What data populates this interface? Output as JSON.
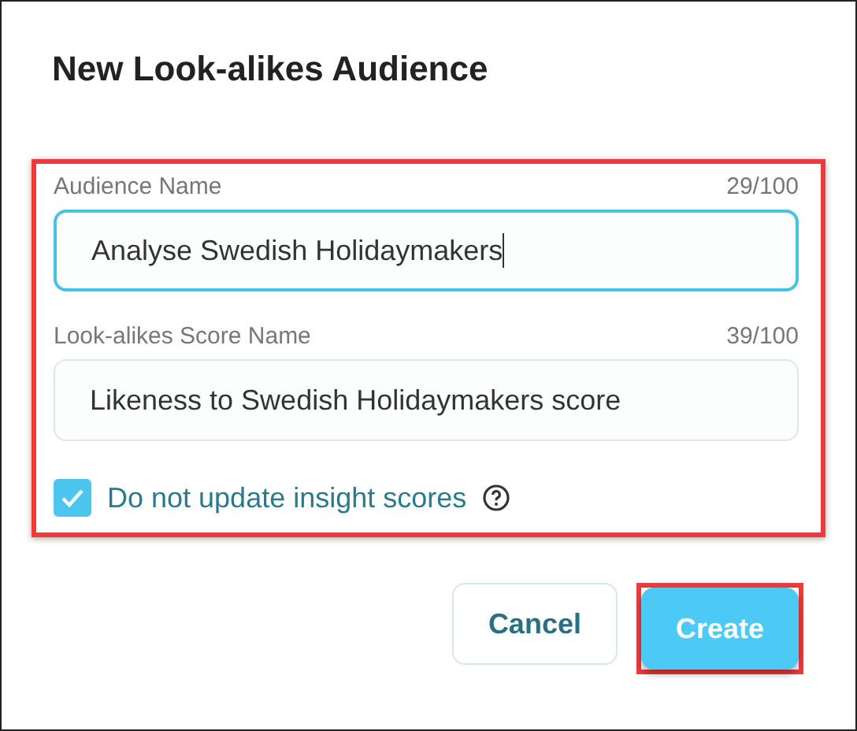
{
  "dialog": {
    "title": "New Look-alikes Audience"
  },
  "fields": [
    {
      "label": "Audience Name",
      "counter": "29/100",
      "value": "Analyse Swedish Holidaymakers",
      "focused": true
    },
    {
      "label": "Look-alikes Score Name",
      "counter": "39/100",
      "value": "Likeness to Swedish Holidaymakers score",
      "focused": false
    }
  ],
  "checkbox": {
    "label": "Do not update insight scores",
    "checked": true
  },
  "buttons": [
    {
      "label": "Cancel",
      "kind": "secondary"
    },
    {
      "label": "Create",
      "kind": "primary"
    }
  ]
}
